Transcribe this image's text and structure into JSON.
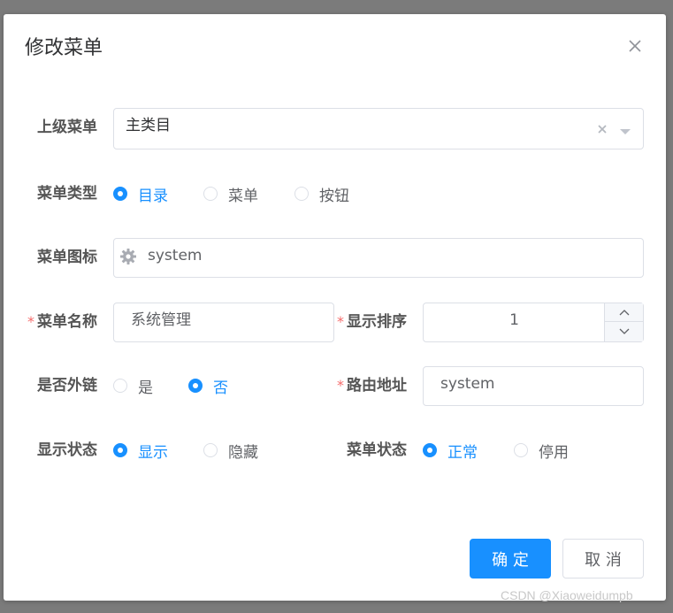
{
  "dialog": {
    "title": "修改菜单",
    "confirm_label": "确 定",
    "cancel_label": "取 消"
  },
  "form": {
    "parent_menu": {
      "label": "上级菜单",
      "value": "主类目"
    },
    "menu_type": {
      "label": "菜单类型",
      "options": [
        "目录",
        "菜单",
        "按钮"
      ],
      "selected": "目录"
    },
    "menu_icon": {
      "label": "菜单图标",
      "value": "system",
      "icon": "gear-icon"
    },
    "menu_name": {
      "label": "菜单名称",
      "required": "*",
      "value": "系统管理"
    },
    "sort_order": {
      "label": "显示排序",
      "required": "*",
      "value": "1"
    },
    "is_external": {
      "label": "是否外链",
      "options": [
        "是",
        "否"
      ],
      "selected": "否"
    },
    "route_path": {
      "label": "路由地址",
      "required": "*",
      "value": "system"
    },
    "visible": {
      "label": "显示状态",
      "options": [
        "显示",
        "隐藏"
      ],
      "selected": "显示"
    },
    "status": {
      "label": "菜单状态",
      "options": [
        "正常",
        "停用"
      ],
      "selected": "正常"
    }
  },
  "watermark": "CSDN @Xiaoweidumpb",
  "colors": {
    "primary": "#1890ff",
    "required": "#f56c6c",
    "border": "#dcdfe6",
    "overlay": "#7b7b7b"
  }
}
